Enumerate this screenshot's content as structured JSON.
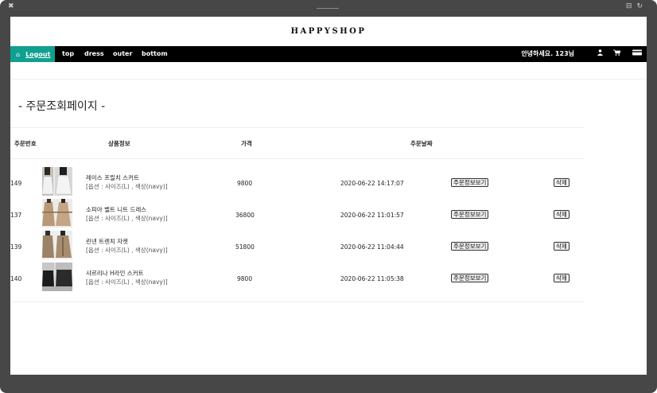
{
  "brand": "HAPPYSHOP",
  "nav": {
    "logout": "Logout",
    "links": [
      "top",
      "dress",
      "outer",
      "bottom"
    ],
    "greeting": "안녕하세요. 123님",
    "icons": [
      "home-icon",
      "user-icon",
      "cart-icon",
      "card-icon"
    ]
  },
  "page_title": "- 주문조회페이지 -",
  "table": {
    "headers": {
      "order_no": "주문번호",
      "product": "상품정보",
      "price": "가격",
      "date": "주문날짜"
    },
    "rows": [
      {
        "order_no": "149",
        "name": "레이스 프릴치 스커트",
        "option": "[옵션 : 사이즈(L) , 색상(navy)]",
        "price": "9800",
        "date": "2020-06-22 14:17:07",
        "detail": "주문정보보기",
        "delete": "삭제"
      },
      {
        "order_no": "137",
        "name": "소피아 벨트 니트 드레스",
        "option": "[옵션 : 사이즈(L) , 색상(navy)]",
        "price": "36800",
        "date": "2020-06-22 11:01:57",
        "detail": "주문정보보기",
        "delete": "삭제"
      },
      {
        "order_no": "139",
        "name": "린넨 트렌치 자켓",
        "option": "[옵션 : 사이즈(L) , 색상(navy)]",
        "price": "51800",
        "date": "2020-06-22 11:04:44",
        "detail": "주문정보보기",
        "delete": "삭제"
      },
      {
        "order_no": "140",
        "name": "샤르리나 H라인 스커트",
        "option": "[옵션 : 사이즈(L) , 색상(navy)]",
        "price": "9800",
        "date": "2020-06-22 11:05:38",
        "detail": "주문정보보기",
        "delete": "삭제"
      }
    ]
  }
}
